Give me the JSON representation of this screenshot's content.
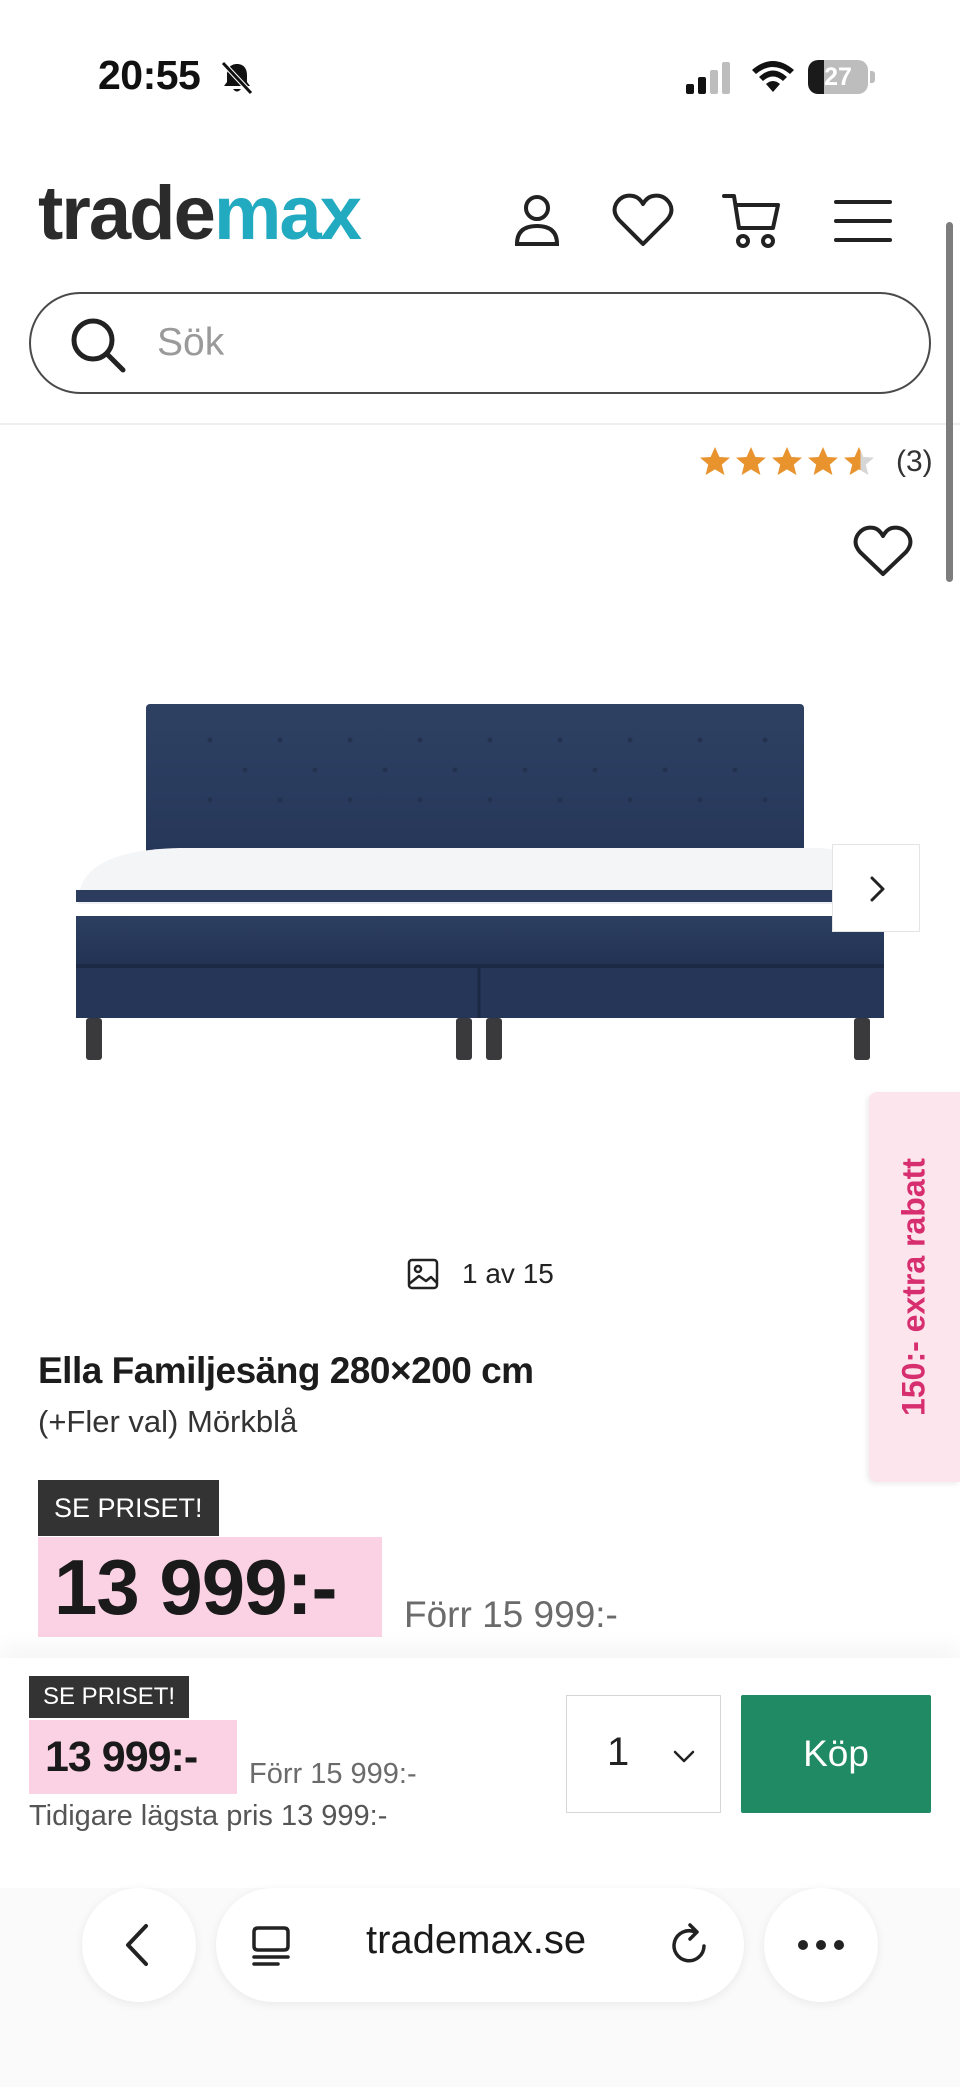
{
  "status_bar": {
    "time": "20:55",
    "battery_level": "27",
    "battery_fraction": 0.27
  },
  "header": {
    "logo_part1": "trade",
    "logo_part2": "max",
    "logo_colors": {
      "trade": "#2b2b2b",
      "max": "#22aac0"
    },
    "icons": [
      "account-icon",
      "wishlist-icon",
      "cart-icon",
      "menu-icon"
    ]
  },
  "search": {
    "placeholder": "Sök",
    "value": ""
  },
  "product": {
    "rating": 4.5,
    "rating_count": "(3)",
    "image_counter": "1 av 15",
    "title": "Ella Familjesäng 280×200 cm",
    "variant": "(+Fler val) Mörkblå",
    "badge": "SE PRISET!",
    "price": "13 999:-",
    "old_price": "Förr 15 999:-"
  },
  "promo": {
    "label": "150:- extra rabatt",
    "color": "#d72e6f"
  },
  "buy_bar": {
    "badge": "SE PRISET!",
    "price": "13 999:-",
    "old_price": "Förr 15 999:-",
    "lowest_price": "Tidigare lägsta pris 13 999:-",
    "quantity": "1",
    "buy_label": "Köp",
    "buy_color": "#1f8a63",
    "price_highlight": "#fbd2e3"
  },
  "browser": {
    "url": "trademax.se"
  }
}
